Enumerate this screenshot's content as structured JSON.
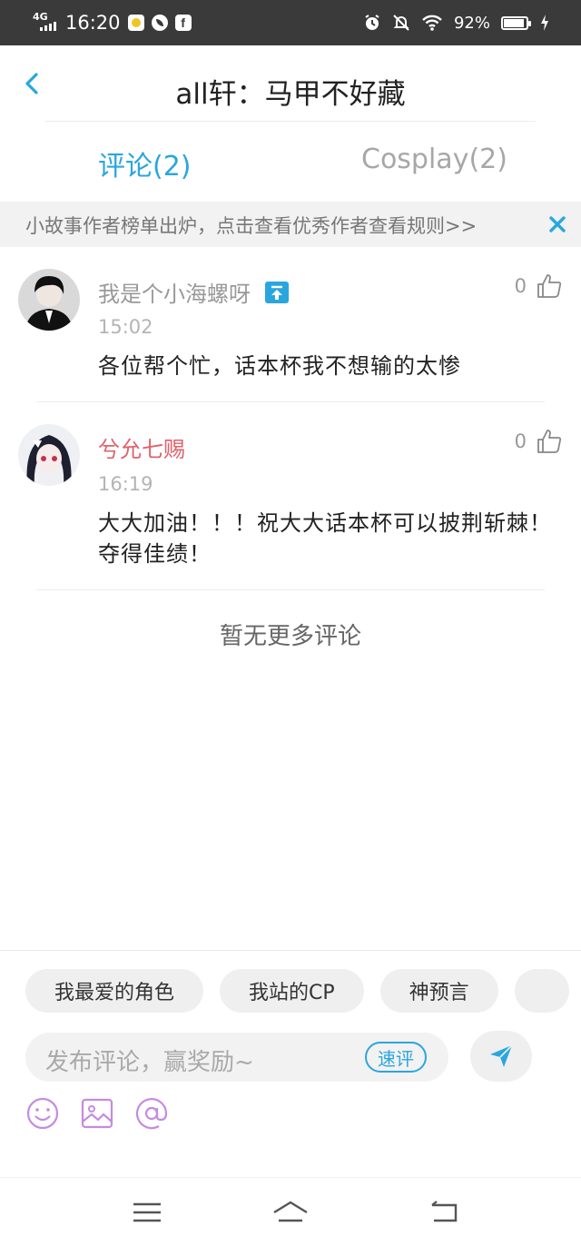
{
  "status_bar": {
    "network": "4G",
    "time": "16:20",
    "battery": "92%",
    "battery_level": 0.92,
    "app_icons": [
      "app-yellow-icon",
      "leaf-app-icon",
      "facebook-icon"
    ],
    "right_icons": [
      "alarm-icon",
      "mute-notification-icon",
      "wifi-icon",
      "battery-icon",
      "charging-icon"
    ]
  },
  "header": {
    "title": "all轩：马甲不好藏",
    "back_icon": "chevron-left-icon"
  },
  "tabs": [
    {
      "label": "评论(2)",
      "active": true
    },
    {
      "label": "Cosplay(2)",
      "active": false
    }
  ],
  "notice": {
    "text": "小故事作者榜单出炉，点击查看优秀作者查看规则>>",
    "close_icon": "close-icon"
  },
  "comments": [
    {
      "username": "我是个小海螺呀",
      "username_color": "#999999",
      "has_badge": true,
      "time": "15:02",
      "text": "各位帮个忙，话本杯我不想输的太惨",
      "likes": "0"
    },
    {
      "username": "兮允七赐",
      "username_color": "#e0626b",
      "has_badge": false,
      "time": "16:19",
      "text": "大大加油！！！祝大大话本杯可以披荆斩棘！夺得佳绩！",
      "likes": "0"
    }
  ],
  "no_more": "暂无更多评论",
  "input_area": {
    "chips": [
      "我最爱的角色",
      "我站的CP",
      "神预言"
    ],
    "placeholder": "发布评论，赢奖励~",
    "quick_label": "速评",
    "send_icon": "send-icon",
    "tool_icons": [
      "emoji-icon",
      "image-icon",
      "mention-icon"
    ]
  },
  "nav_bar": {
    "icons": [
      "menu-icon",
      "home-icon",
      "back-icon"
    ]
  },
  "colors": {
    "accent": "#2aa6df",
    "status_bar_bg": "#3a3a3a",
    "tool_icon": "#c58be0",
    "notice_bg": "#f2f2f2"
  }
}
